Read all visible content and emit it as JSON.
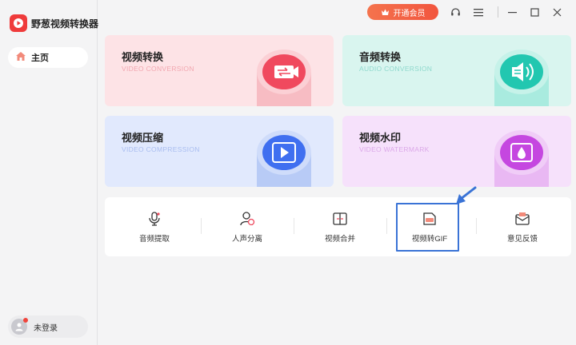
{
  "app": {
    "title": "野葱视频转换器"
  },
  "sidebar": {
    "home_label": "主页",
    "login_label": "未登录"
  },
  "header": {
    "vip_label": "开通会员"
  },
  "cards": [
    {
      "title": "视频转换",
      "subtitle": "VIDEO CONVERSION",
      "accent": "#f0495e",
      "subtitle_color": "#f2a7b0",
      "bg": "#fde3e6"
    },
    {
      "title": "音频转换",
      "subtitle": "AUDIO CONVERSION",
      "accent": "#22c7b0",
      "subtitle_color": "#8fd9cd",
      "bg": "#d9f5ef"
    },
    {
      "title": "视频压缩",
      "subtitle": "VIDEO COMPRESSION",
      "accent": "#3f6ff0",
      "subtitle_color": "#a9bdf0",
      "bg": "#e1e9fd"
    },
    {
      "title": "视频水印",
      "subtitle": "VIDEO WATERMARK",
      "accent": "#c547e0",
      "subtitle_color": "#dba8e8",
      "bg": "#f6e1fb"
    }
  ],
  "tools": [
    {
      "label": "音频提取",
      "icon": "microphone-icon"
    },
    {
      "label": "人声分离",
      "icon": "voice-separation-icon"
    },
    {
      "label": "视频合并",
      "icon": "video-merge-icon"
    },
    {
      "label": "视频转GIF",
      "icon": "gif-icon"
    },
    {
      "label": "意见反馈",
      "icon": "feedback-mail-icon"
    }
  ],
  "annotation": {
    "highlight_color": "#3a73d6"
  }
}
